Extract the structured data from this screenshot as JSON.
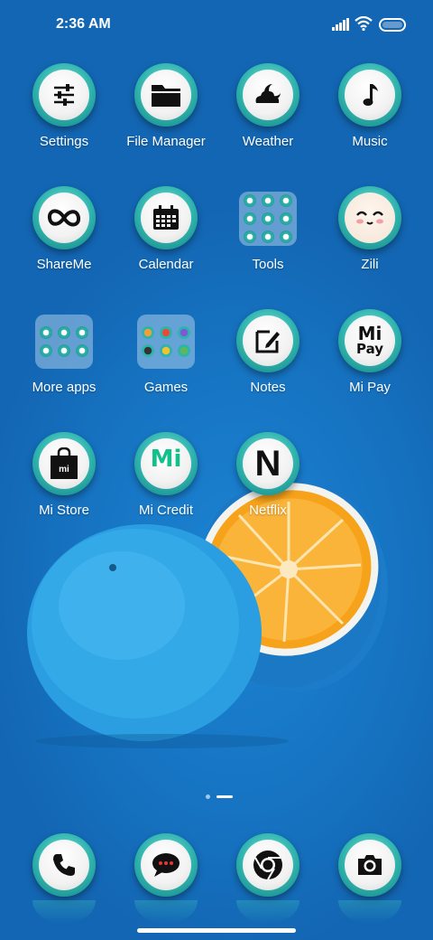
{
  "status_bar": {
    "time": "2:36 AM",
    "icons": [
      "signal-icon",
      "wifi-icon",
      "battery-icon"
    ]
  },
  "apps": [
    {
      "label": "Settings",
      "icon": "sliders-icon"
    },
    {
      "label": "File Manager",
      "icon": "folder-icon"
    },
    {
      "label": "Weather",
      "icon": "cloud-moon-icon"
    },
    {
      "label": "Music",
      "icon": "music-note-icon"
    },
    {
      "label": "ShareMe",
      "icon": "infinity-icon"
    },
    {
      "label": "Calendar",
      "icon": "calendar-icon"
    },
    {
      "label": "Tools",
      "icon": "folder-tools-icon"
    },
    {
      "label": "Zili",
      "icon": "zili-face-icon"
    },
    {
      "label": "More apps",
      "icon": "folder-more-apps-icon"
    },
    {
      "label": "Games",
      "icon": "folder-games-icon"
    },
    {
      "label": "Notes",
      "icon": "note-edit-icon"
    },
    {
      "label": "Mi Pay",
      "icon": "mi-pay-icon",
      "logo_text": [
        "Mi",
        "Pay"
      ]
    },
    {
      "label": "Mi Store",
      "icon": "shopping-bag-icon",
      "logo_text": "mi"
    },
    {
      "label": "Mi Credit",
      "icon": "mi-credit-icon",
      "logo_text": "Mi"
    },
    {
      "label": "Netflix",
      "icon": "netflix-n-icon",
      "logo_text": "N"
    }
  ],
  "dock": [
    {
      "icon": "phone-icon"
    },
    {
      "icon": "messages-icon"
    },
    {
      "icon": "chrome-icon"
    },
    {
      "icon": "camera-icon"
    }
  ],
  "page_indicator": {
    "pages": 2,
    "current": 2
  },
  "colors": {
    "wallpaper": "#1777c6",
    "ring": "#2fb3ad",
    "icon_face": "#f2f2f2",
    "orange_flesh": "#f7a21b"
  }
}
